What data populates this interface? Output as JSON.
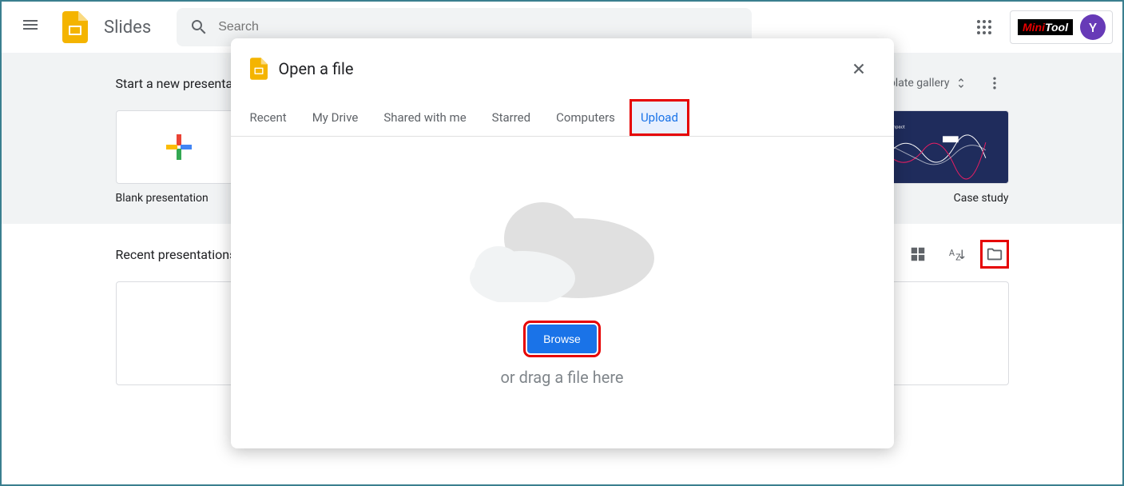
{
  "header": {
    "app_name": "Slides",
    "search_placeholder": "Search",
    "avatar_letter": "Y",
    "minitool_mini": "Mini",
    "minitool_tool": "Tool"
  },
  "gallery": {
    "title": "Start a new presentation",
    "link_text": "Template gallery",
    "templates": [
      {
        "name": "Blank presentation"
      },
      {
        "name": "Case study"
      }
    ]
  },
  "recent": {
    "title": "Recent presentations"
  },
  "modal": {
    "title": "Open a file",
    "tabs": [
      {
        "label": "Recent",
        "active": false
      },
      {
        "label": "My Drive",
        "active": false
      },
      {
        "label": "Shared with me",
        "active": false
      },
      {
        "label": "Starred",
        "active": false
      },
      {
        "label": "Computers",
        "active": false
      },
      {
        "label": "Upload",
        "active": true
      }
    ],
    "browse_label": "Browse",
    "drag_text": "or drag a file here"
  }
}
